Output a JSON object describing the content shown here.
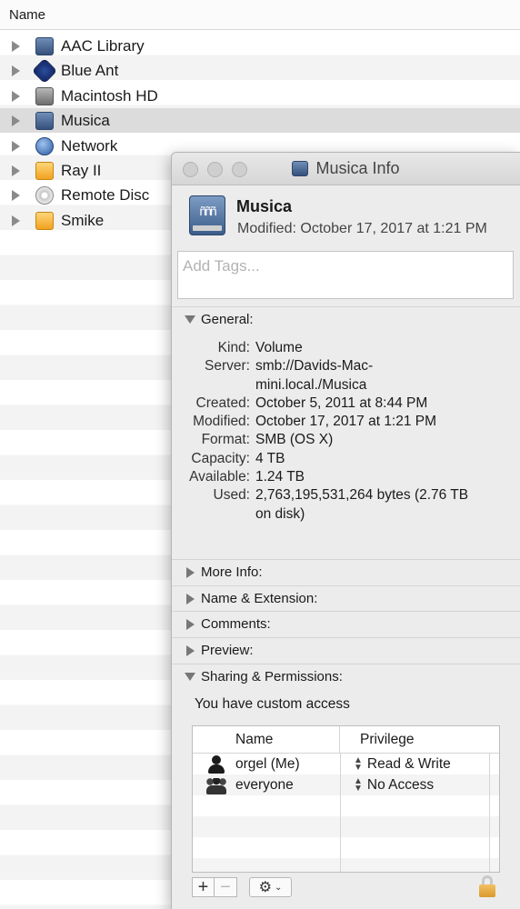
{
  "finder": {
    "column_header": "Name",
    "items": [
      {
        "label": "AAC Library",
        "icon": "server-volume-icon"
      },
      {
        "label": "Blue Ant",
        "icon": "blue-ant-icon"
      },
      {
        "label": "Macintosh HD",
        "icon": "hard-drive-icon"
      },
      {
        "label": "Musica",
        "icon": "server-volume-icon",
        "selected": true
      },
      {
        "label": "Network",
        "icon": "network-globe-icon"
      },
      {
        "label": "Ray II",
        "icon": "external-drive-icon"
      },
      {
        "label": "Remote Disc",
        "icon": "remote-disc-icon"
      },
      {
        "label": "Smike",
        "icon": "external-drive-icon"
      }
    ]
  },
  "info": {
    "window_title": "Musica Info",
    "name": "Musica",
    "modified_summary": "Modified: October 17, 2017 at 1:21 PM",
    "tags_placeholder": "Add Tags...",
    "general": {
      "header": "General:",
      "kind_label": "Kind:",
      "kind": "Volume",
      "server_label": "Server:",
      "server_line1": "smb://Davids-Mac-",
      "server_line2": "mini.local./Musica",
      "created_label": "Created:",
      "created": "October 5, 2011 at 8:44 PM",
      "modified_label": "Modified:",
      "modified": "October 17, 2017 at 1:21 PM",
      "format_label": "Format:",
      "format": "SMB (OS X)",
      "capacity_label": "Capacity:",
      "capacity": "4 TB",
      "available_label": "Available:",
      "available": "1.24 TB",
      "used_label": "Used:",
      "used_line1": "2,763,195,531,264 bytes (2.76 TB",
      "used_line2": "on disk)"
    },
    "sections": {
      "more_info": "More Info:",
      "name_extension": "Name & Extension:",
      "comments": "Comments:",
      "preview": "Preview:",
      "sharing": "Sharing & Permissions:"
    },
    "sharing": {
      "access_note": "You have custom access",
      "col_name": "Name",
      "col_privilege": "Privilege",
      "rows": [
        {
          "name": "orgel (Me)",
          "privilege": "Read & Write"
        },
        {
          "name": "everyone",
          "privilege": "No Access"
        }
      ],
      "add_symbol": "+",
      "remove_symbol": "−",
      "action_symbol": "⚙",
      "chevron_symbol": "⌄",
      "updown_up": "▲",
      "updown_down": "▼"
    },
    "colors": {
      "window_bg": "#ececec",
      "selected_row": "#dcdcdc",
      "lock_gold": "#d99a2b"
    }
  }
}
